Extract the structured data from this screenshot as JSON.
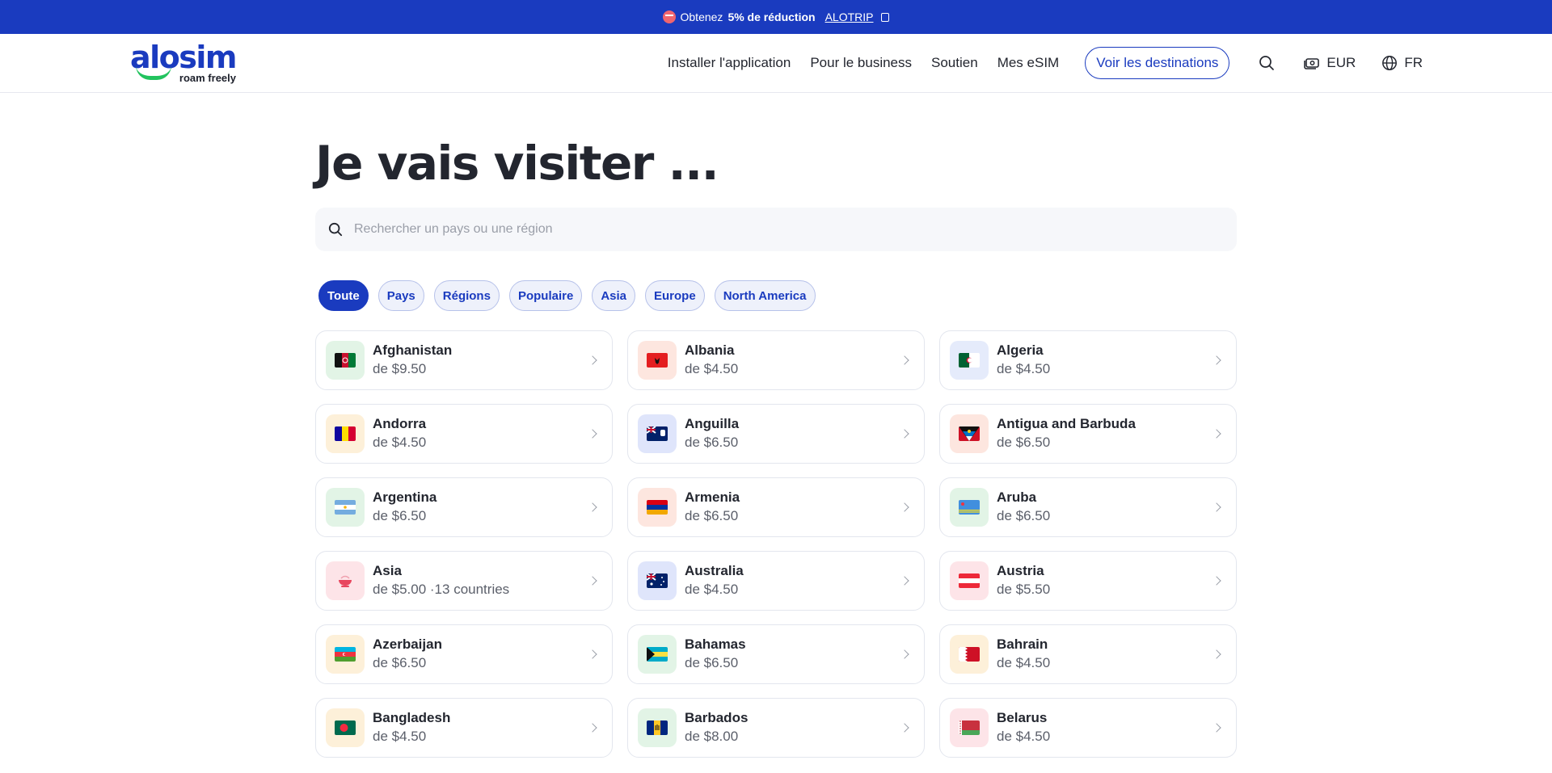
{
  "promo": {
    "prefix": "Obtenez",
    "bold": "5% de réduction",
    "code": "ALOTRIP"
  },
  "header": {
    "logo_word": "alosim",
    "logo_tagline": "roam freely",
    "nav": [
      "Installer l'application",
      "Pour le business",
      "Soutien",
      "Mes eSIM"
    ],
    "cta": "Voir les destinations",
    "currency": "EUR",
    "language": "FR"
  },
  "main": {
    "title": "Je vais visiter ...",
    "search_placeholder": "Rechercher un pays ou une région",
    "filters": [
      "Toute",
      "Pays",
      "Régions",
      "Populaire",
      "Asia",
      "Europe",
      "North America"
    ],
    "active_filter": "Toute",
    "destinations": [
      {
        "name": "Afghanistan",
        "price": "de $9.50",
        "flag": "af",
        "tint": "#e2f4e6"
      },
      {
        "name": "Albania",
        "price": "de $4.50",
        "flag": "al",
        "tint": "#fde6df"
      },
      {
        "name": "Algeria",
        "price": "de $4.50",
        "flag": "dz",
        "tint": "#e5ebfb"
      },
      {
        "name": "Andorra",
        "price": "de $4.50",
        "flag": "ad",
        "tint": "#fdf0d9"
      },
      {
        "name": "Anguilla",
        "price": "de $6.50",
        "flag": "ai",
        "tint": "#dfe5fb"
      },
      {
        "name": "Antigua and Barbuda",
        "price": "de $6.50",
        "flag": "ag",
        "tint": "#fde6df"
      },
      {
        "name": "Argentina",
        "price": "de $6.50",
        "flag": "ar",
        "tint": "#e2f4e6"
      },
      {
        "name": "Armenia",
        "price": "de $6.50",
        "flag": "am",
        "tint": "#fde6df"
      },
      {
        "name": "Aruba",
        "price": "de $6.50",
        "flag": "aw",
        "tint": "#e2f4e6"
      },
      {
        "name": "Asia",
        "price": "de $5.00 ·13 countries",
        "flag": "asia",
        "tint": "#fde4e8"
      },
      {
        "name": "Australia",
        "price": "de $4.50",
        "flag": "au",
        "tint": "#dfe5fb"
      },
      {
        "name": "Austria",
        "price": "de $5.50",
        "flag": "at",
        "tint": "#fde4e8"
      },
      {
        "name": "Azerbaijan",
        "price": "de $6.50",
        "flag": "az",
        "tint": "#fdf0d9"
      },
      {
        "name": "Bahamas",
        "price": "de $6.50",
        "flag": "bs",
        "tint": "#e2f4e6"
      },
      {
        "name": "Bahrain",
        "price": "de $4.50",
        "flag": "bh",
        "tint": "#fdf0d9"
      },
      {
        "name": "Bangladesh",
        "price": "de $4.50",
        "flag": "bd",
        "tint": "#fdf0d9"
      },
      {
        "name": "Barbados",
        "price": "de $8.00",
        "flag": "bb",
        "tint": "#e2f4e6"
      },
      {
        "name": "Belarus",
        "price": "de $4.50",
        "flag": "by",
        "tint": "#fde4e8"
      }
    ]
  }
}
